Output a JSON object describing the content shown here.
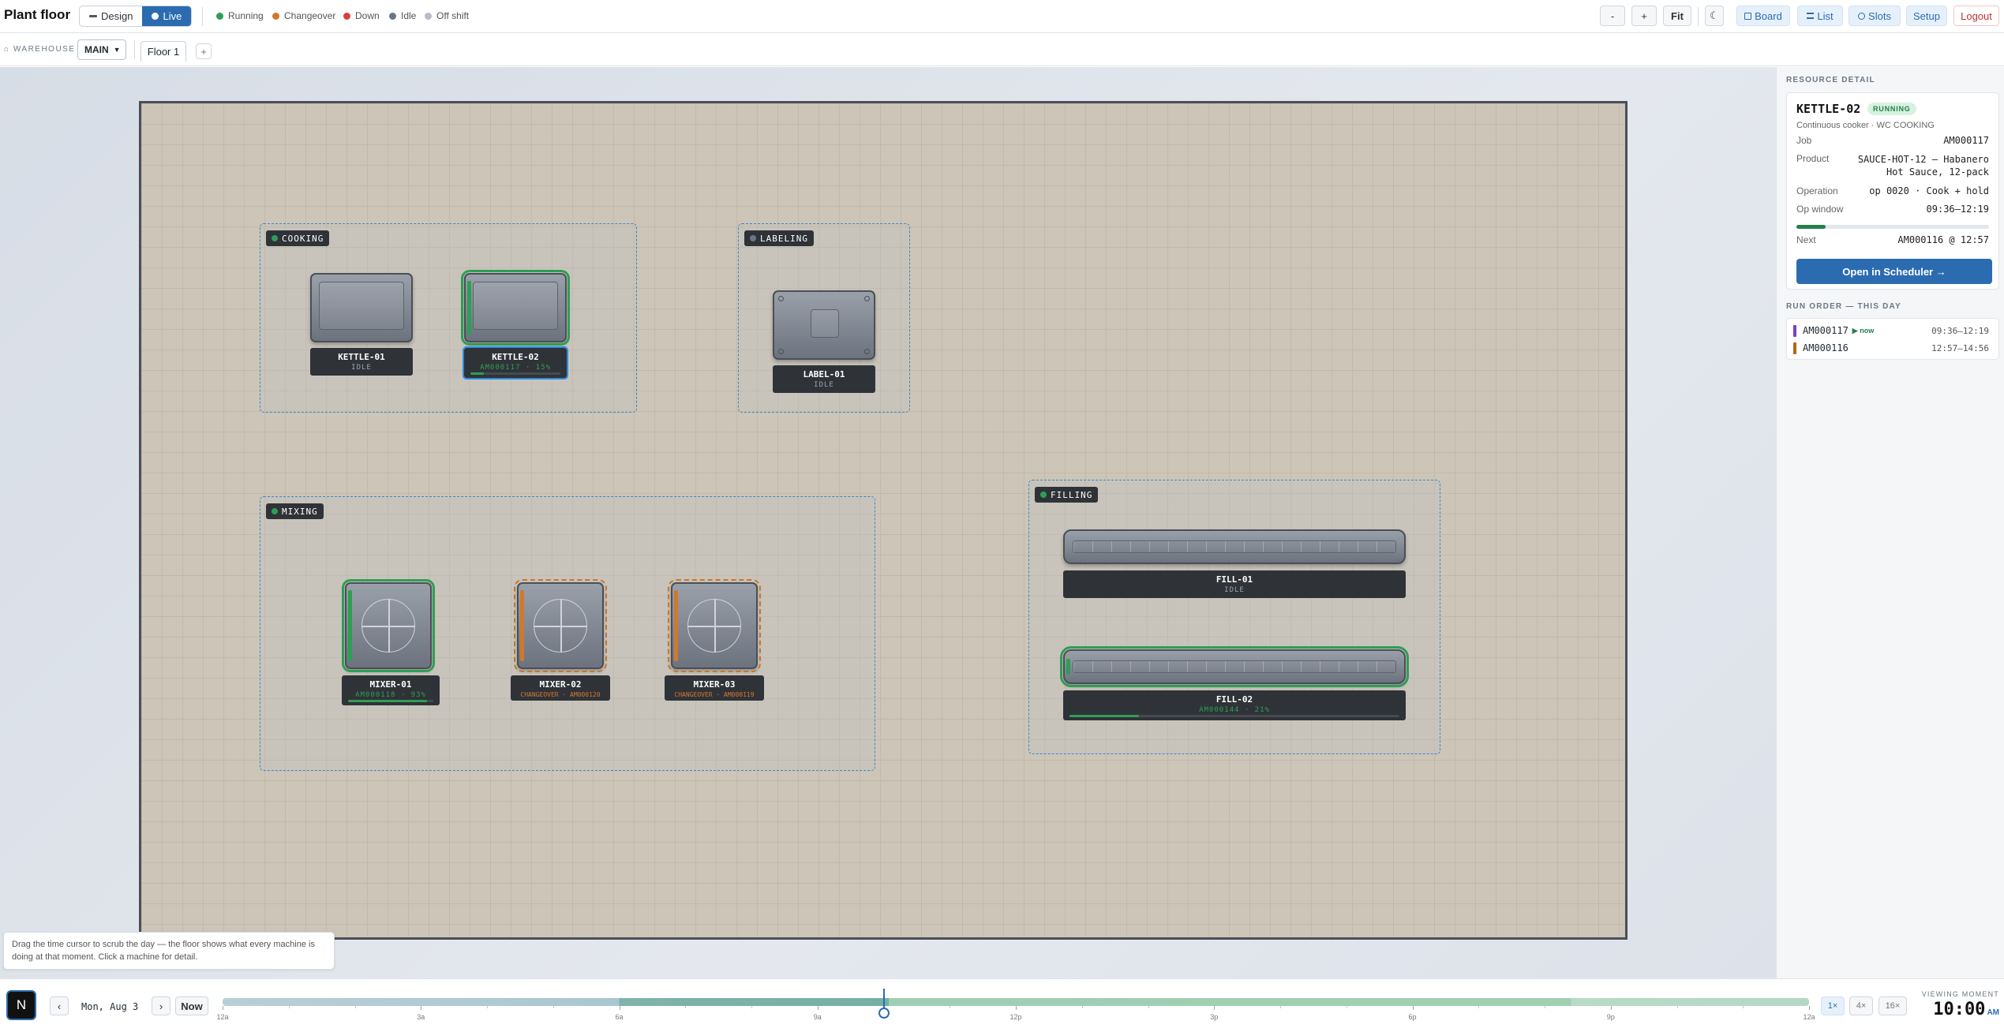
{
  "header": {
    "title": "Plant floor",
    "mode_design": "Design",
    "mode_live": "Live",
    "legend": [
      {
        "label": "Running",
        "color": "#2f9e55"
      },
      {
        "label": "Changeover",
        "color": "#d2772c"
      },
      {
        "label": "Down",
        "color": "#d64040"
      },
      {
        "label": "Idle",
        "color": "#6b7785"
      },
      {
        "label": "Off shift",
        "color": "#b5bcc5"
      }
    ],
    "zoom_out": "-",
    "zoom_in": "+",
    "fit": "Fit",
    "theme": "☾",
    "nav": {
      "board": "Board",
      "list": "List",
      "slots": "Slots",
      "setup": "Setup",
      "logout": "Logout"
    }
  },
  "subbar": {
    "warehouse_label": "WAREHOUSE",
    "warehouse_value": "MAIN",
    "floor_tab": "Floor 1",
    "add_tab": "+"
  },
  "zones": {
    "cooking": "COOKING",
    "labeling": "LABELING",
    "mixing": "MIXING",
    "filling": "FILLING"
  },
  "machines": {
    "kettle01": {
      "name": "KETTLE-01",
      "status": "IDLE"
    },
    "kettle02": {
      "name": "KETTLE-02",
      "status": "AM000117 · 15%",
      "progress": 0.15
    },
    "label01": {
      "name": "LABEL-01",
      "status": "IDLE"
    },
    "mixer01": {
      "name": "MIXER-01",
      "status": "AM000118 · 93%",
      "progress": 0.93
    },
    "mixer02": {
      "name": "MIXER-02",
      "status": "CHANGEOVER · AM000120"
    },
    "mixer03": {
      "name": "MIXER-03",
      "status": "CHANGEOVER · AM000119"
    },
    "fill01": {
      "name": "FILL-01",
      "status": "IDLE"
    },
    "fill02": {
      "name": "FILL-02",
      "status": "AM000144 · 21%",
      "progress": 0.21
    }
  },
  "detail": {
    "section_title": "RESOURCE DETAIL",
    "name": "KETTLE-02",
    "badge": "RUNNING",
    "subtitle": "Continuous cooker · WC COOKING",
    "job_label": "Job",
    "job": "AM000117",
    "product_label": "Product",
    "product": "SAUCE-HOT-12 — Habanero Hot Sauce, 12-pack",
    "operation_label": "Operation",
    "operation": "op 0020 · Cook + hold",
    "window_label": "Op window",
    "window": "09:36–12:19",
    "window_progress": 0.15,
    "next_label": "Next",
    "next": "AM000116 @ 12:57",
    "open_button": "Open in Scheduler →"
  },
  "run_order": {
    "title": "RUN ORDER — THIS DAY",
    "items": [
      {
        "job": "AM000117",
        "tag": "▶ now",
        "window": "09:36–12:19",
        "color": "#7b3fc4"
      },
      {
        "job": "AM000116",
        "tag": "",
        "window": "12:57–14:56",
        "color": "#b5651d"
      }
    ]
  },
  "help_tip": "Drag the time cursor to scrub the day — the floor shows what every machine is doing at that moment. Click a machine for detail.",
  "timeline": {
    "logo": "N",
    "prev": "‹",
    "date": "Mon, Aug 3",
    "next": "›",
    "now": "Now",
    "ticks": [
      "12a",
      "3a",
      "6a",
      "9a",
      "12p",
      "3p",
      "6p",
      "9p",
      "12a"
    ],
    "cursor_hour": 10,
    "speeds": [
      "1×",
      "4×",
      "16×"
    ],
    "viewing_label": "VIEWING MOMENT",
    "viewing_time": "10:00",
    "viewing_ampm": "AM"
  }
}
